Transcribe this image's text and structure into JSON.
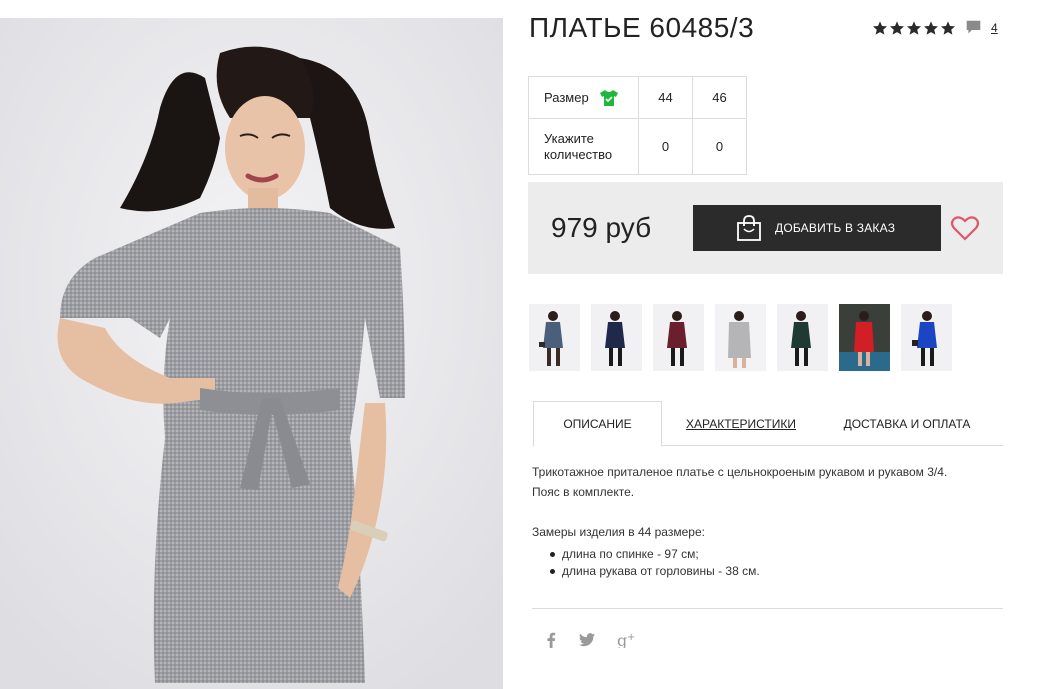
{
  "product": {
    "title": "ПЛАТЬЕ 60485/3",
    "rating_icons": [
      "star-icon",
      "star-icon",
      "star-icon",
      "star-icon",
      "star-icon"
    ],
    "review_count": "4",
    "main_image_icon": "product-photo-woman-in-grey-dress"
  },
  "size_table": {
    "size_label": "Размер",
    "sizes": [
      "44",
      "46"
    ],
    "quantity_label_line1": "Укажите",
    "quantity_label_line2": "количество",
    "quantities": [
      "0",
      "0"
    ],
    "size_icon_color": "#1fb83c"
  },
  "purchase": {
    "price": "979 руб",
    "add_button_label": "ДОБАВИТЬ В ЗАКАЗ",
    "heart_color": "#e0566b"
  },
  "thumbnails": [
    {
      "color": "#4a5f7a",
      "desc": "blue-grey dress"
    },
    {
      "color": "#1f2a4a",
      "desc": "navy dress"
    },
    {
      "color": "#6b1e2c",
      "desc": "burgundy dress"
    },
    {
      "color": "#b5b5b8",
      "desc": "grey dress"
    },
    {
      "color": "#1f3a32",
      "desc": "dark green dress"
    },
    {
      "color": "#d11f25",
      "desc": "red dress"
    },
    {
      "color": "#1c45c4",
      "desc": "royal blue dress"
    }
  ],
  "tabs": [
    {
      "label": "ОПИСАНИЕ"
    },
    {
      "label": "ХАРАКТЕРИСТИКИ"
    },
    {
      "label": "ДОСТАВКА И ОПЛАТА"
    }
  ],
  "description": {
    "line1": "Трикотажное приталеное платье с цельнокроеным рукавом и рукавом 3/4.",
    "line2": "Пояс в комплекте.",
    "measurements_title": "Замеры изделия в 44 размере:",
    "bullets": [
      "длина по спинке - 97 см;",
      "длина рукава от горловины - 38 см."
    ]
  },
  "social": [
    "facebook-icon",
    "twitter-icon",
    "google-plus-icon"
  ]
}
